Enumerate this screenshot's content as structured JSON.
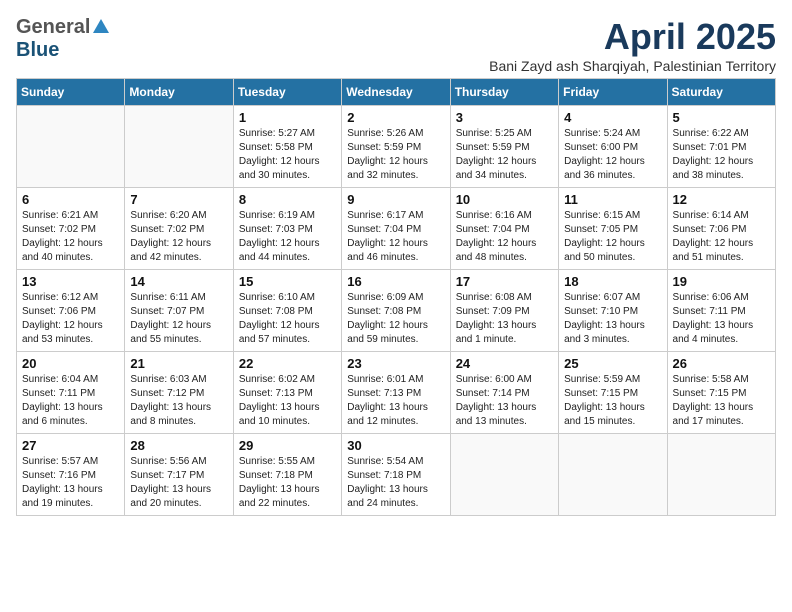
{
  "header": {
    "logo_general": "General",
    "logo_blue": "Blue",
    "month_title": "April 2025",
    "location": "Bani Zayd ash Sharqiyah, Palestinian Territory"
  },
  "calendar": {
    "weekdays": [
      "Sunday",
      "Monday",
      "Tuesday",
      "Wednesday",
      "Thursday",
      "Friday",
      "Saturday"
    ],
    "weeks": [
      [
        {
          "day": "",
          "content": ""
        },
        {
          "day": "",
          "content": ""
        },
        {
          "day": "1",
          "content": "Sunrise: 5:27 AM\nSunset: 5:58 PM\nDaylight: 12 hours and 30 minutes."
        },
        {
          "day": "2",
          "content": "Sunrise: 5:26 AM\nSunset: 5:59 PM\nDaylight: 12 hours and 32 minutes."
        },
        {
          "day": "3",
          "content": "Sunrise: 5:25 AM\nSunset: 5:59 PM\nDaylight: 12 hours and 34 minutes."
        },
        {
          "day": "4",
          "content": "Sunrise: 5:24 AM\nSunset: 6:00 PM\nDaylight: 12 hours and 36 minutes."
        },
        {
          "day": "5",
          "content": "Sunrise: 6:22 AM\nSunset: 7:01 PM\nDaylight: 12 hours and 38 minutes."
        }
      ],
      [
        {
          "day": "6",
          "content": "Sunrise: 6:21 AM\nSunset: 7:02 PM\nDaylight: 12 hours and 40 minutes."
        },
        {
          "day": "7",
          "content": "Sunrise: 6:20 AM\nSunset: 7:02 PM\nDaylight: 12 hours and 42 minutes."
        },
        {
          "day": "8",
          "content": "Sunrise: 6:19 AM\nSunset: 7:03 PM\nDaylight: 12 hours and 44 minutes."
        },
        {
          "day": "9",
          "content": "Sunrise: 6:17 AM\nSunset: 7:04 PM\nDaylight: 12 hours and 46 minutes."
        },
        {
          "day": "10",
          "content": "Sunrise: 6:16 AM\nSunset: 7:04 PM\nDaylight: 12 hours and 48 minutes."
        },
        {
          "day": "11",
          "content": "Sunrise: 6:15 AM\nSunset: 7:05 PM\nDaylight: 12 hours and 50 minutes."
        },
        {
          "day": "12",
          "content": "Sunrise: 6:14 AM\nSunset: 7:06 PM\nDaylight: 12 hours and 51 minutes."
        }
      ],
      [
        {
          "day": "13",
          "content": "Sunrise: 6:12 AM\nSunset: 7:06 PM\nDaylight: 12 hours and 53 minutes."
        },
        {
          "day": "14",
          "content": "Sunrise: 6:11 AM\nSunset: 7:07 PM\nDaylight: 12 hours and 55 minutes."
        },
        {
          "day": "15",
          "content": "Sunrise: 6:10 AM\nSunset: 7:08 PM\nDaylight: 12 hours and 57 minutes."
        },
        {
          "day": "16",
          "content": "Sunrise: 6:09 AM\nSunset: 7:08 PM\nDaylight: 12 hours and 59 minutes."
        },
        {
          "day": "17",
          "content": "Sunrise: 6:08 AM\nSunset: 7:09 PM\nDaylight: 13 hours and 1 minute."
        },
        {
          "day": "18",
          "content": "Sunrise: 6:07 AM\nSunset: 7:10 PM\nDaylight: 13 hours and 3 minutes."
        },
        {
          "day": "19",
          "content": "Sunrise: 6:06 AM\nSunset: 7:11 PM\nDaylight: 13 hours and 4 minutes."
        }
      ],
      [
        {
          "day": "20",
          "content": "Sunrise: 6:04 AM\nSunset: 7:11 PM\nDaylight: 13 hours and 6 minutes."
        },
        {
          "day": "21",
          "content": "Sunrise: 6:03 AM\nSunset: 7:12 PM\nDaylight: 13 hours and 8 minutes."
        },
        {
          "day": "22",
          "content": "Sunrise: 6:02 AM\nSunset: 7:13 PM\nDaylight: 13 hours and 10 minutes."
        },
        {
          "day": "23",
          "content": "Sunrise: 6:01 AM\nSunset: 7:13 PM\nDaylight: 13 hours and 12 minutes."
        },
        {
          "day": "24",
          "content": "Sunrise: 6:00 AM\nSunset: 7:14 PM\nDaylight: 13 hours and 13 minutes."
        },
        {
          "day": "25",
          "content": "Sunrise: 5:59 AM\nSunset: 7:15 PM\nDaylight: 13 hours and 15 minutes."
        },
        {
          "day": "26",
          "content": "Sunrise: 5:58 AM\nSunset: 7:15 PM\nDaylight: 13 hours and 17 minutes."
        }
      ],
      [
        {
          "day": "27",
          "content": "Sunrise: 5:57 AM\nSunset: 7:16 PM\nDaylight: 13 hours and 19 minutes."
        },
        {
          "day": "28",
          "content": "Sunrise: 5:56 AM\nSunset: 7:17 PM\nDaylight: 13 hours and 20 minutes."
        },
        {
          "day": "29",
          "content": "Sunrise: 5:55 AM\nSunset: 7:18 PM\nDaylight: 13 hours and 22 minutes."
        },
        {
          "day": "30",
          "content": "Sunrise: 5:54 AM\nSunset: 7:18 PM\nDaylight: 13 hours and 24 minutes."
        },
        {
          "day": "",
          "content": ""
        },
        {
          "day": "",
          "content": ""
        },
        {
          "day": "",
          "content": ""
        }
      ]
    ]
  }
}
